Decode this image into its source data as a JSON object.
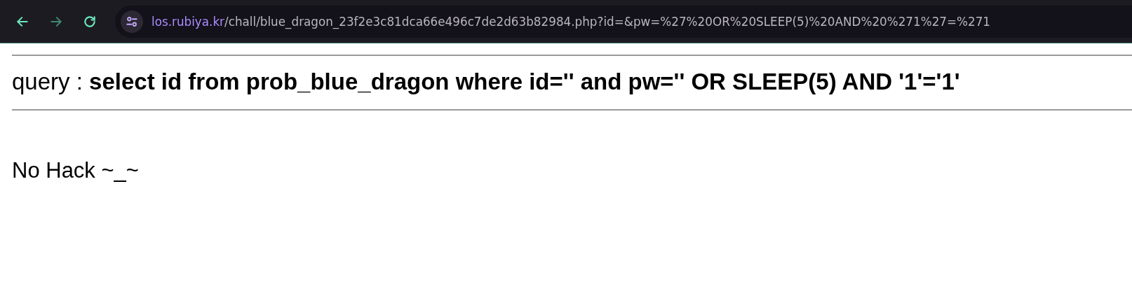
{
  "browser": {
    "back_disabled": false,
    "forward_disabled": true,
    "address": {
      "host": "los.rubiya.kr",
      "path": "/chall/blue_dragon_23f2e3c81dca66e496c7de2d63b82984.php?id=&pw=%27%20OR%20SLEEP(5)%20AND%20%271%27=%271"
    }
  },
  "page": {
    "query": "query : **select id from prob_blue_dragon where id='' and pw='' OR SLEEP(5) AND '1'='1'**",
    "message": "No Hack ~_~"
  }
}
